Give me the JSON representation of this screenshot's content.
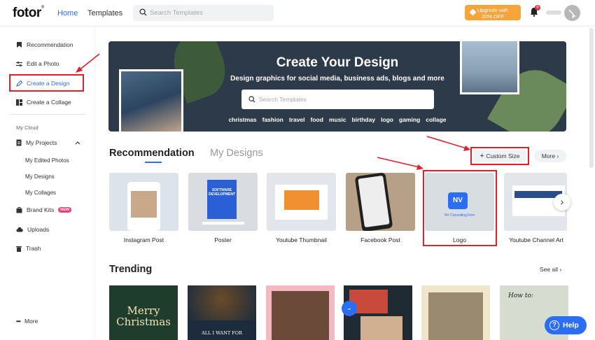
{
  "header": {
    "logo": "fotor",
    "logo_mark": "®",
    "nav": {
      "home": "Home",
      "templates": "Templates"
    },
    "search_placeholder": "Search Templates",
    "upgrade_line1": "Upgrade with",
    "upgrade_line2": "20% OFF",
    "notification_count": "6"
  },
  "sidebar": {
    "items": [
      {
        "label": "Recommendation",
        "icon": "bookmark-icon"
      },
      {
        "label": "Edit a Photo",
        "icon": "sliders-icon"
      },
      {
        "label": "Create a Design",
        "icon": "pen-icon"
      },
      {
        "label": "Create a Collage",
        "icon": "collage-icon"
      }
    ],
    "group_label": "My Cloud",
    "projects": {
      "label": "My Projects",
      "children": [
        "My Edited Photos",
        "My Designs",
        "My Collages"
      ]
    },
    "brand_kits": {
      "label": "Brand Kits",
      "badge": "NEW"
    },
    "uploads": "Uploads",
    "trash": "Trash",
    "more": "More"
  },
  "banner": {
    "title": "Create Your Design",
    "subtitle": "Design graphics for social media, business ads, blogs and more",
    "search_placeholder": "Search Templates",
    "tags": [
      "christmas",
      "fashion",
      "travel",
      "food",
      "music",
      "birthday",
      "logo",
      "gaming",
      "collage"
    ]
  },
  "recommendation": {
    "tab_active": "Recommendation",
    "tab_inactive": "My Designs",
    "custom_size": "Custom Size",
    "more": "More",
    "cards": [
      "Instagram Post",
      "Poster",
      "Youtube Thumbnail",
      "Facebook Post",
      "Logo",
      "Youtube Channel Art"
    ],
    "poster_text": "SOFTWARE DEVELOPMENT",
    "logo_text": "NV",
    "logo_company": "NV Consulting Firm"
  },
  "trending": {
    "title": "Trending",
    "see_all": "See all",
    "card1_text": "Merry Christmas",
    "card2_text": "ALL I WANT FOR"
  },
  "help": "Help",
  "colors": {
    "accent": "#2a6ef5",
    "upgrade": "#f7a43a",
    "highlight": "#e0202a",
    "banner_bg": "#2d3a4a"
  }
}
